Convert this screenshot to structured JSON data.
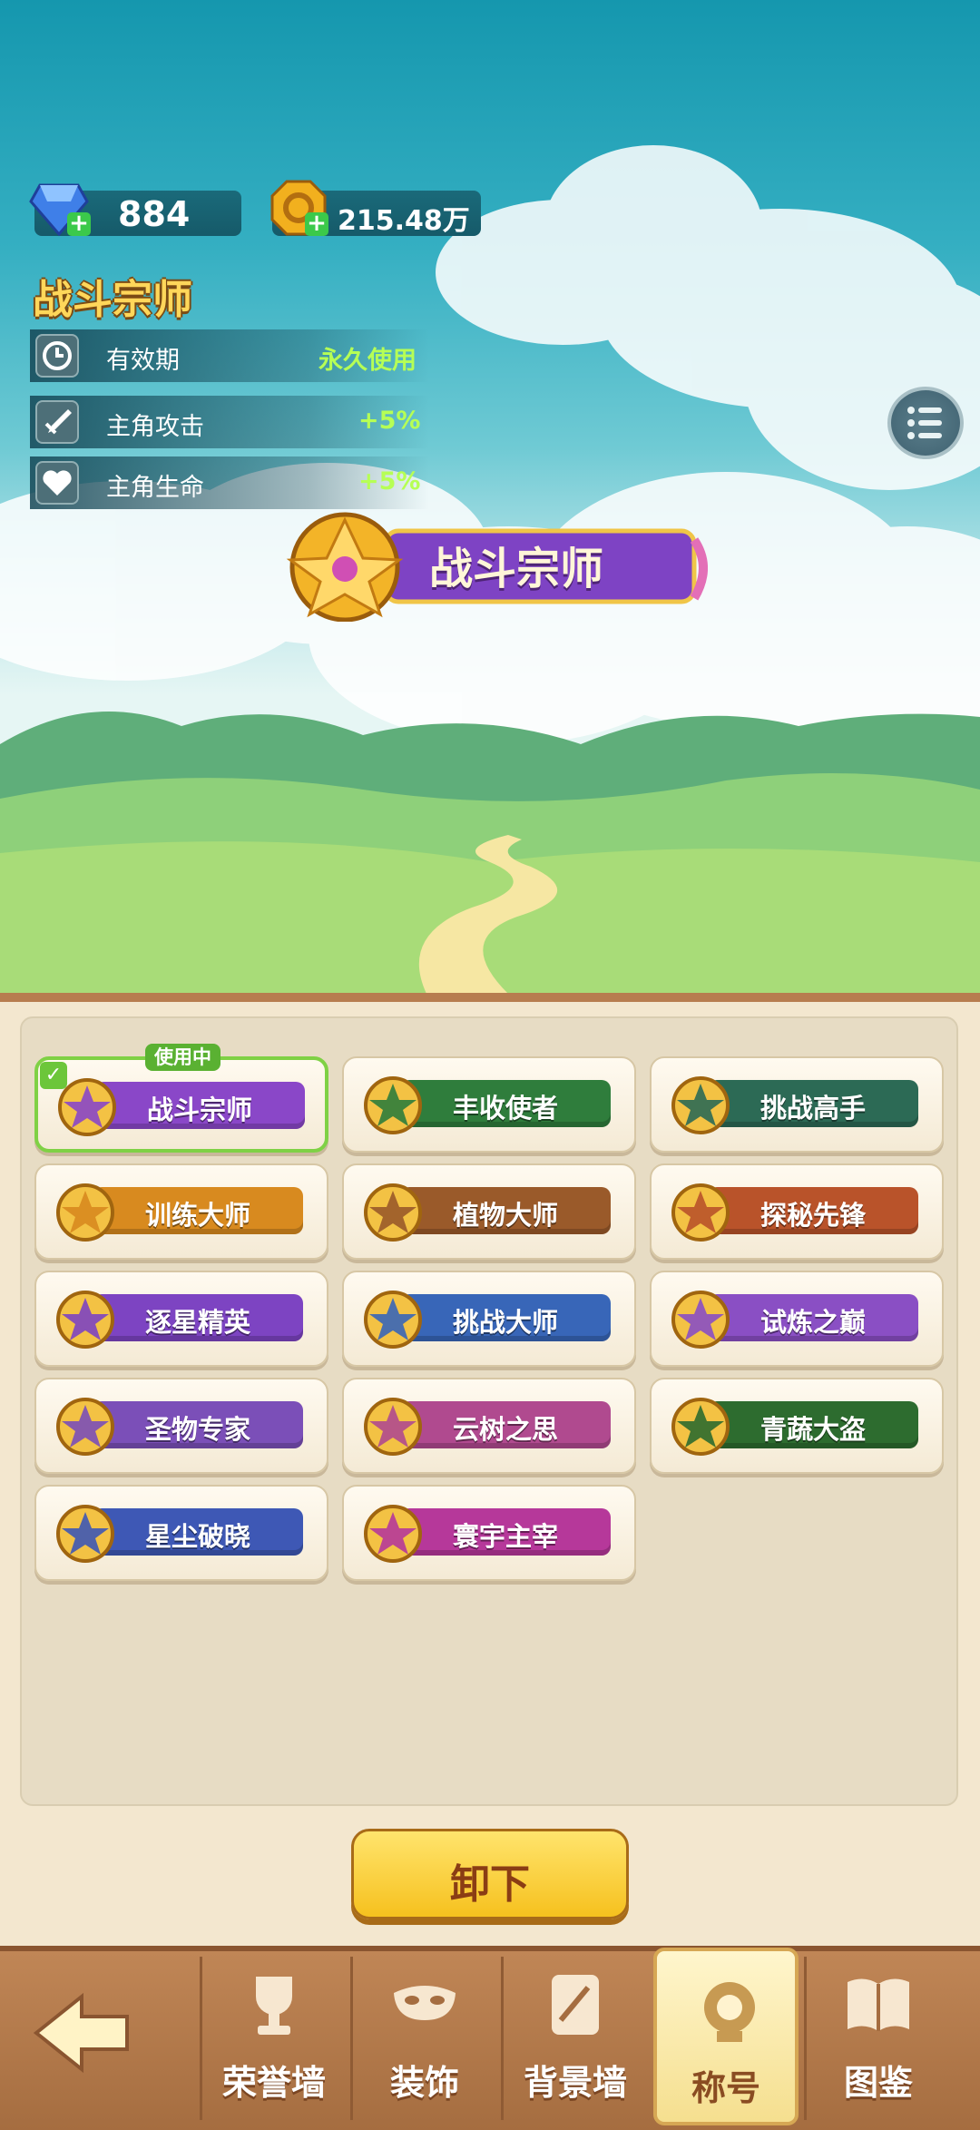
{
  "currency": {
    "gems": "884",
    "coins": "215.48万"
  },
  "title_detail": {
    "name": "战斗宗师",
    "stats": [
      {
        "label": "有效期",
        "value": "永久使用",
        "icon": "clock-icon"
      },
      {
        "label": "主角攻击",
        "value": "+5%",
        "icon": "sword-icon"
      },
      {
        "label": "主角生命",
        "value": "+5%",
        "icon": "heart-icon"
      }
    ],
    "badge_text": "战斗宗师"
  },
  "in_use_label": "使用中",
  "titles": [
    {
      "name": "战斗宗师",
      "color": "#8a47c8"
    },
    {
      "name": "丰收使者",
      "color": "#2f7d3c"
    },
    {
      "name": "挑战高手",
      "color": "#2c6a55"
    },
    {
      "name": "训练大师",
      "color": "#d88a1f"
    },
    {
      "name": "植物大师",
      "color": "#9a5a2a"
    },
    {
      "name": "探秘先锋",
      "color": "#b9532a"
    },
    {
      "name": "逐星精英",
      "color": "#7d44c2"
    },
    {
      "name": "挑战大师",
      "color": "#3866b8"
    },
    {
      "name": "试炼之巅",
      "color": "#8a4fc4"
    },
    {
      "name": "圣物专家",
      "color": "#7b4fb8"
    },
    {
      "name": "云树之思",
      "color": "#b04a8f"
    },
    {
      "name": "青蔬大盗",
      "color": "#2d6c2f"
    },
    {
      "name": "星尘破晓",
      "color": "#3e58b5"
    },
    {
      "name": "寰宇主宰",
      "color": "#b6389a"
    }
  ],
  "unequip_label": "卸下",
  "nav": [
    {
      "label": "荣誉墙",
      "icon": "trophy-icon"
    },
    {
      "label": "装饰",
      "icon": "mask-icon"
    },
    {
      "label": "背景墙",
      "icon": "picture-icon"
    },
    {
      "label": "称号",
      "icon": "medal-icon"
    },
    {
      "label": "图鉴",
      "icon": "book-icon"
    }
  ]
}
